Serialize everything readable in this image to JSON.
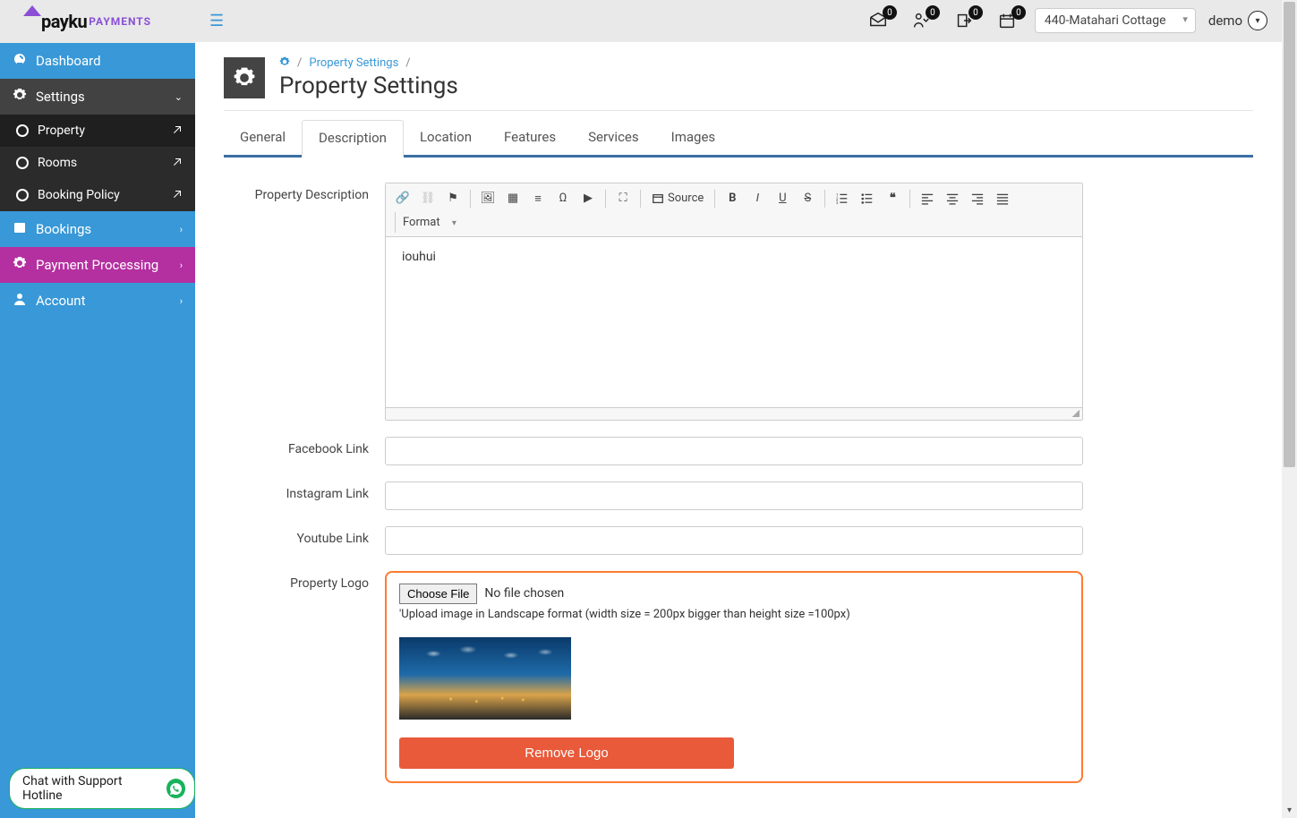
{
  "logo": {
    "brand1": "payku",
    "brand2": "PAYMENTS"
  },
  "topbar": {
    "badges": {
      "mail": "0",
      "checkin": "0",
      "checkout": "0",
      "calendar": "0"
    },
    "property_select": "440-Matahari Cottage",
    "user": "demo"
  },
  "sidebar": {
    "dashboard": "Dashboard",
    "settings": "Settings",
    "sub": {
      "property": "Property",
      "rooms": "Rooms",
      "booking_policy": "Booking Policy"
    },
    "bookings": "Bookings",
    "payment": "Payment Processing",
    "account": "Account",
    "chat": "Chat with Support Hotline"
  },
  "breadcrumb": {
    "link": "Property Settings"
  },
  "page_title": "Property Settings",
  "tabs": {
    "general": "General",
    "description": "Description",
    "location": "Location",
    "features": "Features",
    "services": "Services",
    "images": "Images"
  },
  "editor": {
    "source_label": "Source",
    "format_label": "Format",
    "content": "iouhui"
  },
  "labels": {
    "description": "Property Description",
    "facebook": "Facebook Link",
    "instagram": "Instagram Link",
    "youtube": "Youtube Link",
    "logo": "Property Logo"
  },
  "logo_section": {
    "choose": "Choose File",
    "no_file": "No file chosen",
    "hint": "'Upload image in Landscape format (width size = 200px bigger than height size =100px)",
    "remove": "Remove Logo"
  }
}
